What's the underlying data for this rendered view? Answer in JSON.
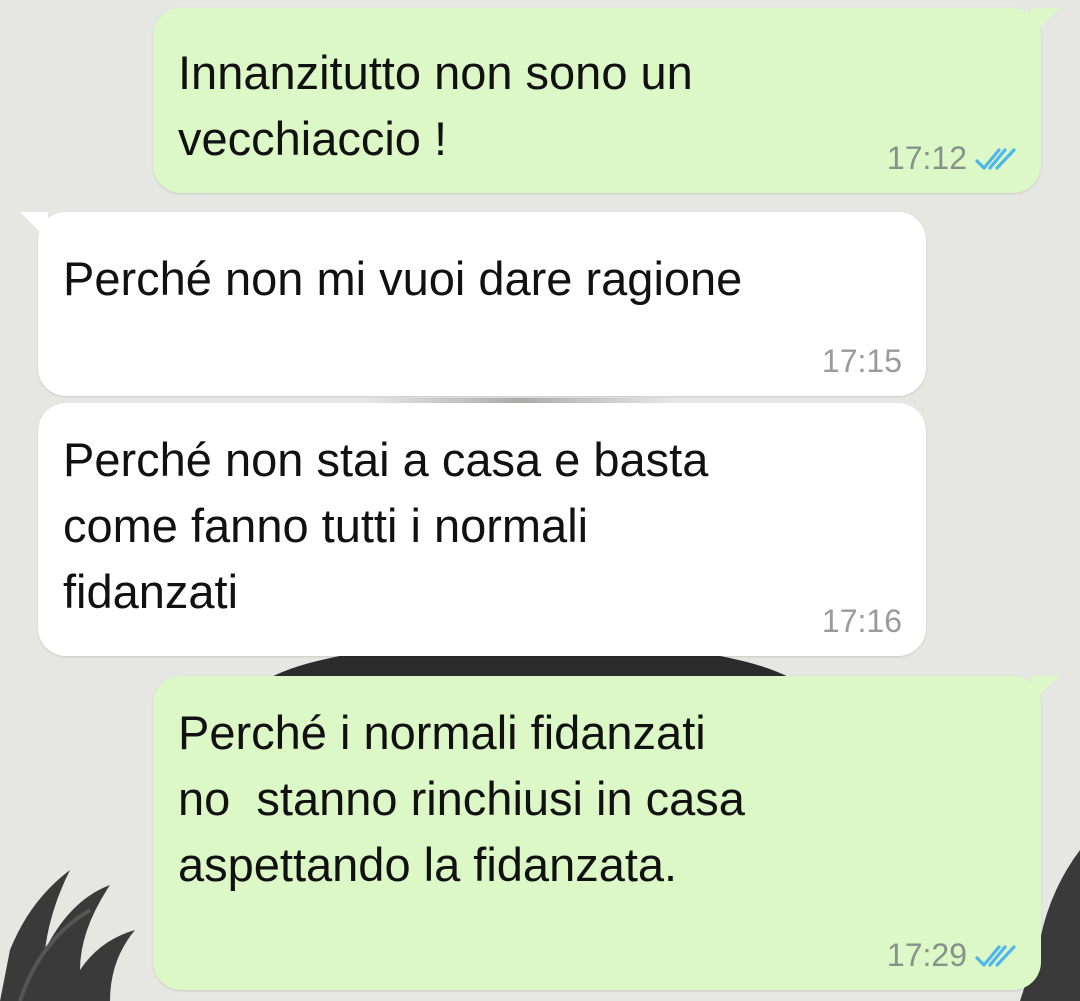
{
  "colors": {
    "outgoing_bubble": "#dcf8c6",
    "incoming_bubble": "#ffffff",
    "read_ticks": "#4fb6ec",
    "timestamp": "#8a918a"
  },
  "messages": [
    {
      "direction": "outgoing",
      "text": "Innanzitutto non sono un\nvecchiaccio !",
      "time": "17:12",
      "status_icon": "double-check-read-icon"
    },
    {
      "direction": "incoming",
      "text": "Perché non mi vuoi dare ragione",
      "time": "17:15"
    },
    {
      "direction": "incoming",
      "text": "Perché non stai a casa e basta\ncome fanno tutti i normali\nfidanzati",
      "time": "17:16"
    },
    {
      "direction": "outgoing",
      "text": "Perché i normali fidanzati\nno  stanno rinchiusi in casa\naspettando la fidanzata.",
      "time": "17:29",
      "status_icon": "double-check-read-icon"
    }
  ]
}
